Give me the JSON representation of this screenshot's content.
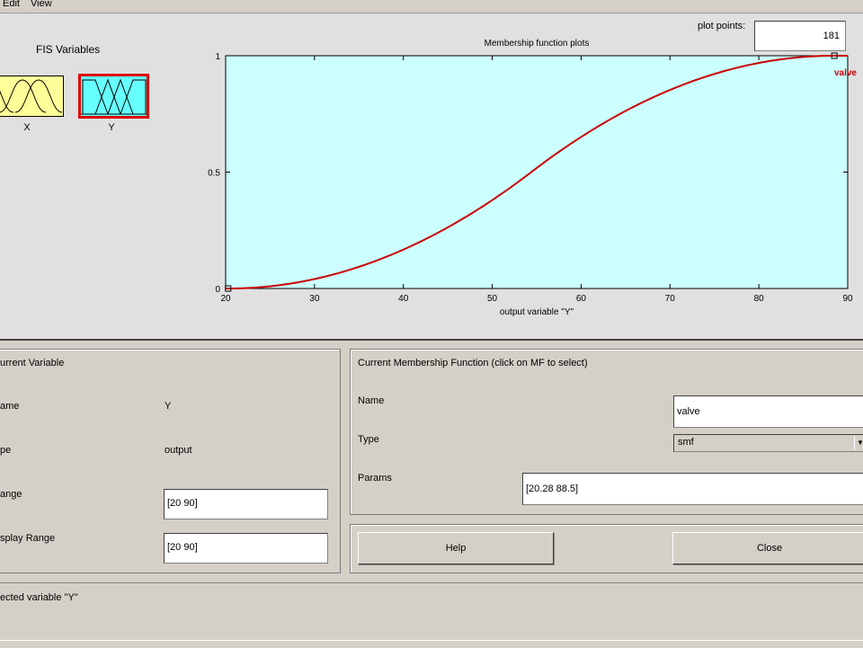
{
  "menu": {
    "items": [
      "Edit",
      "View"
    ]
  },
  "fis_variables": {
    "title": "FIS Variables",
    "inputs": [
      {
        "label": "X"
      }
    ],
    "outputs": [
      {
        "label": "Y",
        "selected": true
      }
    ]
  },
  "plot_points": {
    "label": "plot points:",
    "value": "181"
  },
  "chart_data": {
    "type": "line",
    "title": "Membership function plots",
    "xlabel": "output variable \"Y\"",
    "ylabel": "",
    "xlim": [
      20,
      90
    ],
    "ylim": [
      0,
      1
    ],
    "x_ticks": [
      20,
      30,
      40,
      50,
      60,
      70,
      80,
      90
    ],
    "y_ticks": [
      0,
      0.5,
      1
    ],
    "y_tick_labels": [
      "0",
      "0.5",
      "1"
    ],
    "series": [
      {
        "name": "valve",
        "function": "smf",
        "params": [
          20.28,
          88.5
        ],
        "color": "#cc0000"
      }
    ],
    "background": "#ccffff"
  },
  "current_variable": {
    "title": "urrent Variable",
    "name_label": "ame",
    "name_value": "Y",
    "type_label": "pe",
    "type_value": "output",
    "range_label": "ange",
    "range_value": "[20 90]",
    "display_range_label": "splay Range",
    "display_range_value": "[20 90]"
  },
  "current_mf": {
    "title": "Current Membership Function (click on MF to select)",
    "name_label": "Name",
    "name_value": "valve",
    "type_label": "Type",
    "type_value": "smf",
    "params_label": "Params",
    "params_value": "[20.28 88.5]"
  },
  "buttons": {
    "help": "Help",
    "close": "Close"
  },
  "status": {
    "text": "ected variable \"Y\""
  },
  "colors": {
    "selected_border": "#e00000",
    "input_box": "#ffff99",
    "output_box": "#66ffff"
  }
}
